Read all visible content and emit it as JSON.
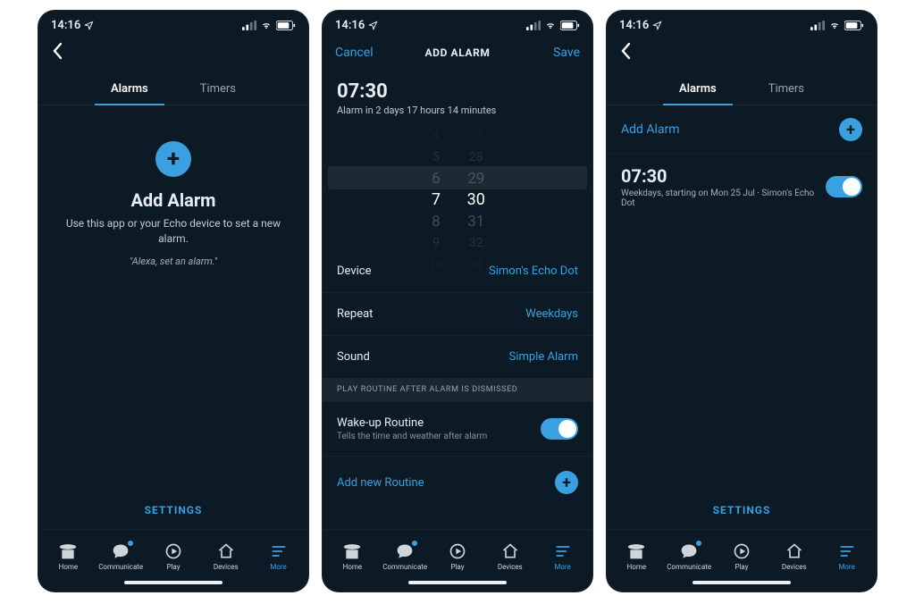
{
  "status": {
    "time": "14:16"
  },
  "tabs": {
    "alarms": "Alarms",
    "timers": "Timers"
  },
  "screen1": {
    "add_title": "Add Alarm",
    "add_sub": "Use this app or your Echo device to set a new alarm.",
    "add_quote": "\"Alexa, set an alarm.\"",
    "settings": "SETTINGS"
  },
  "screen2": {
    "nav": {
      "cancel": "Cancel",
      "title": "ADD ALARM",
      "save": "Save"
    },
    "time": "07:30",
    "countdown": "Alarm in 2 days 17 hours 14 minutes",
    "picker": {
      "hours": [
        "4",
        "5",
        "6",
        "7",
        "8",
        "9",
        "10"
      ],
      "minutes": [
        "27",
        "28",
        "29",
        "30",
        "31",
        "32",
        "33"
      ]
    },
    "rows": {
      "device_label": "Device",
      "device_value": "Simon's Echo Dot",
      "repeat_label": "Repeat",
      "repeat_value": "Weekdays",
      "sound_label": "Sound",
      "sound_value": "Simple Alarm"
    },
    "routine_section_header": "PLAY ROUTINE AFTER ALARM IS DISMISSED",
    "wake_title": "Wake-up Routine",
    "wake_sub": "Tells the time and weather after alarm",
    "add_routine": "Add new Routine"
  },
  "screen3": {
    "add_alarm": "Add Alarm",
    "alarm_time": "07:30",
    "alarm_detail": "Weekdays, starting on Mon 25 Jul · Simon's Echo Dot",
    "settings": "SETTINGS"
  },
  "tabbar": {
    "home": "Home",
    "communicate": "Communicate",
    "play": "Play",
    "devices": "Devices",
    "more": "More"
  }
}
